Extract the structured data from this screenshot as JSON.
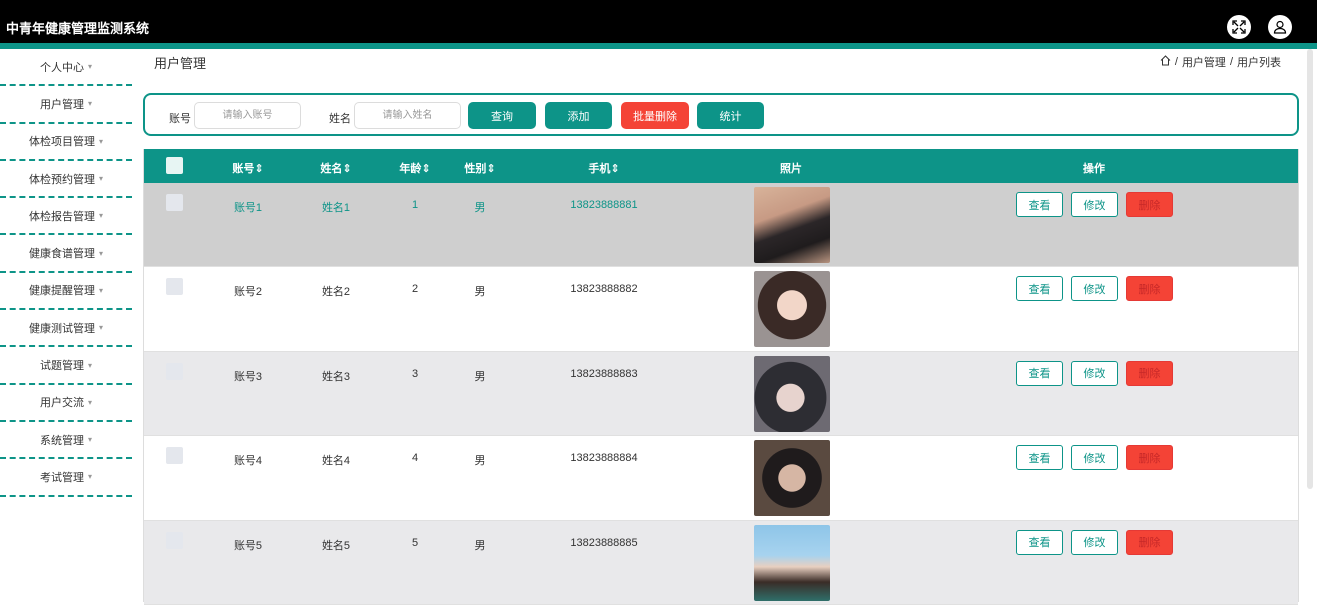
{
  "header": {
    "app_title": "中青年健康管理监测系统",
    "fullscreen_icon": "fullscreen-icon",
    "user_icon": "user-icon"
  },
  "sidebar": {
    "items": [
      {
        "label": "个人中心"
      },
      {
        "label": "用户管理"
      },
      {
        "label": "体检项目管理"
      },
      {
        "label": "体检预约管理"
      },
      {
        "label": "体检报告管理"
      },
      {
        "label": "健康食谱管理"
      },
      {
        "label": "健康提醒管理"
      },
      {
        "label": "健康测试管理"
      },
      {
        "label": "试题管理"
      },
      {
        "label": "用户交流"
      },
      {
        "label": "系统管理"
      },
      {
        "label": "考试管理"
      }
    ],
    "caret": "▾"
  },
  "page": {
    "title": "用户管理"
  },
  "breadcrumb": {
    "sep": "/",
    "level1": "用户管理",
    "level2": "用户列表"
  },
  "search": {
    "account_label": "账号",
    "account_placeholder": "请输入账号",
    "name_label": "姓名",
    "name_placeholder": "请输入姓名",
    "query_btn": "查询",
    "add_btn": "添加",
    "batch_delete_btn": "批量删除",
    "stats_btn": "统计"
  },
  "table": {
    "columns": {
      "account": "账号",
      "name": "姓名",
      "age": "年龄",
      "gender": "性别",
      "phone": "手机",
      "photo": "照片",
      "actions": "操作"
    },
    "sort_mark": "⇕",
    "rows": [
      {
        "account": "账号1",
        "name": "姓名1",
        "age": "1",
        "gender": "男",
        "phone": "13823888881"
      },
      {
        "account": "账号2",
        "name": "姓名2",
        "age": "2",
        "gender": "男",
        "phone": "13823888882"
      },
      {
        "account": "账号3",
        "name": "姓名3",
        "age": "3",
        "gender": "男",
        "phone": "13823888883"
      },
      {
        "account": "账号4",
        "name": "姓名4",
        "age": "4",
        "gender": "男",
        "phone": "13823888884"
      },
      {
        "account": "账号5",
        "name": "姓名5",
        "age": "5",
        "gender": "男",
        "phone": "13823888885"
      }
    ],
    "action_labels": {
      "view": "查看",
      "edit": "修改",
      "delete": "删除"
    }
  },
  "colors": {
    "accent": "#0d9488",
    "danger": "#f44336",
    "topbar": "#000000"
  }
}
